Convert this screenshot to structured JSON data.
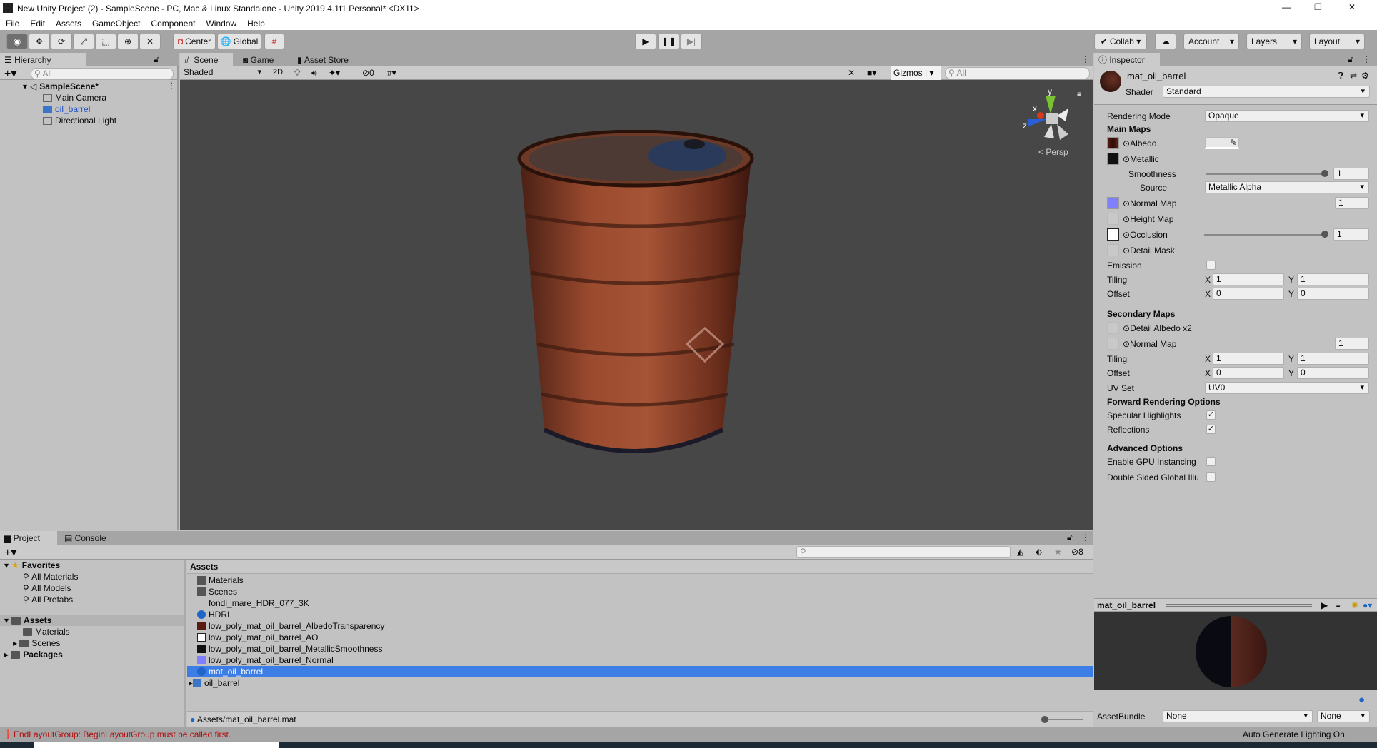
{
  "window": {
    "title": "New Unity Project (2) - SampleScene - PC, Mac & Linux Standalone - Unity 2019.4.1f1 Personal* <DX11>",
    "minimize": "—",
    "maximize": "❐",
    "close": "✕"
  },
  "menu": [
    "File",
    "Edit",
    "Assets",
    "GameObject",
    "Component",
    "Window",
    "Help"
  ],
  "toolbar": {
    "center": "Center",
    "global": "Global",
    "collab": "Collab",
    "account": "Account",
    "layers": "Layers",
    "layout": "Layout"
  },
  "hierarchy": {
    "tab": "Hierarchy",
    "search_placeholder": "All",
    "scene": "SampleScene*",
    "items": [
      "Main Camera",
      "oil_barrel",
      "Directional Light"
    ]
  },
  "scene": {
    "tabs": [
      "Scene",
      "Game",
      "Asset Store"
    ],
    "shading": "Shaded",
    "mode_2d": "2D",
    "hidden_count": "0",
    "gizmos": "Gizmos",
    "search_placeholder": "All",
    "persp": "Persp",
    "axis": {
      "x": "x",
      "y": "y",
      "z": "z"
    }
  },
  "inspector": {
    "tab": "Inspector",
    "name": "mat_oil_barrel",
    "shader_label": "Shader",
    "shader": "Standard",
    "rendering_mode_label": "Rendering Mode",
    "rendering_mode": "Opaque",
    "main_maps": "Main Maps",
    "albedo": "Albedo",
    "metallic": "Metallic",
    "smoothness": "Smoothness",
    "smoothness_value": "1",
    "source_label": "Source",
    "source": "Metallic Alpha",
    "normal_map": "Normal Map",
    "normal_value": "1",
    "height_map": "Height Map",
    "occlusion": "Occlusion",
    "occlusion_value": "1",
    "detail_mask": "Detail Mask",
    "emission": "Emission",
    "tiling": "Tiling",
    "offset": "Offset",
    "x": "X",
    "y": "Y",
    "tiling_x": "1",
    "tiling_y": "1",
    "offset_x": "0",
    "offset_y": "0",
    "secondary_maps": "Secondary Maps",
    "detail_albedo": "Detail Albedo x2",
    "normal_map2": "Normal Map",
    "normal2_value": "1",
    "tiling2_x": "1",
    "tiling2_y": "1",
    "offset2_x": "0",
    "offset2_y": "0",
    "uv_set_label": "UV Set",
    "uv_set": "UV0",
    "forward": "Forward Rendering Options",
    "specular": "Specular Highlights",
    "specular_checked": true,
    "reflections": "Reflections",
    "reflections_checked": true,
    "advanced": "Advanced Options",
    "gpu_instancing": "Enable GPU Instancing",
    "double_sided": "Double Sided Global Illu",
    "preview_title": "mat_oil_barrel",
    "assetbundle_label": "AssetBundle",
    "assetbundle": "None",
    "variant": "None"
  },
  "project": {
    "tabs": [
      "Project",
      "Console"
    ],
    "favorites": "Favorites",
    "favorite_items": [
      "All Materials",
      "All Models",
      "All Prefabs"
    ],
    "assets_root": "Assets",
    "asset_folders": [
      "Materials",
      "Scenes"
    ],
    "packages": "Packages",
    "breadcrumb": "Assets",
    "hidden_count": "8",
    "assets": [
      {
        "name": "Materials",
        "icon": "folder"
      },
      {
        "name": "Scenes",
        "icon": "folder"
      },
      {
        "name": "fondi_mare_HDR_077_3K",
        "icon": "hdr-texture"
      },
      {
        "name": "HDRI",
        "icon": "material"
      },
      {
        "name": "low_poly_mat_oil_barrel_AlbedoTransparency",
        "icon": "texture-albedo"
      },
      {
        "name": "low_poly_mat_oil_barrel_AO",
        "icon": "texture-ao"
      },
      {
        "name": "low_poly_mat_oil_barrel_MetallicSmoothness",
        "icon": "texture-metallic"
      },
      {
        "name": "low_poly_mat_oil_barrel_Normal",
        "icon": "texture-normal"
      },
      {
        "name": "mat_oil_barrel",
        "icon": "material",
        "selected": true
      },
      {
        "name": "oil_barrel",
        "icon": "prefab"
      }
    ],
    "path": "Assets/mat_oil_barrel.mat"
  },
  "status": {
    "error": "EndLayoutGroup: BeginLayoutGroup must be called first.",
    "lighting": "Auto Generate Lighting On"
  },
  "colors": {
    "selection": "#3d7ee6",
    "scene_bg": "#474747",
    "error": "#b01010",
    "accent_blue": "#1e66c8"
  }
}
